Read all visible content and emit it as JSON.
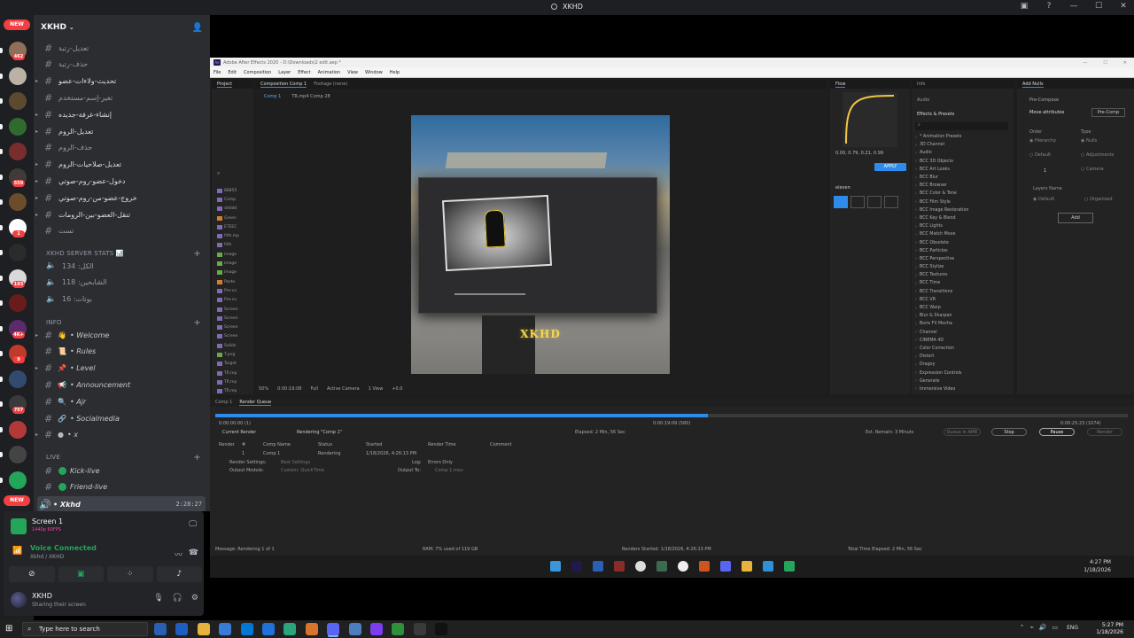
{
  "window": {
    "title": "XKHD",
    "controls": [
      "▣",
      "?",
      "—",
      "☐",
      "✕"
    ]
  },
  "rail": {
    "new_label": "NEW",
    "servers": [
      {
        "badge": "462",
        "color": "#8f6f5a"
      },
      {
        "badge": "",
        "color": "#b9b2a5"
      },
      {
        "badge": "",
        "color": "#5b4a2e"
      },
      {
        "badge": "",
        "color": "#2f6b2f"
      },
      {
        "badge": "",
        "color": "#7a2d2d"
      },
      {
        "badge": "559",
        "color": "#403b38"
      },
      {
        "badge": "",
        "color": "#6b4c2b"
      },
      {
        "badge": "1",
        "color": "#ffffff"
      },
      {
        "badge": "",
        "color": "#2b2b2b"
      },
      {
        "badge": "193",
        "color": "#d9d9d9"
      },
      {
        "badge": "",
        "color": "#6a1b1b"
      },
      {
        "badge": "4K+",
        "color": "#5e2a6e"
      },
      {
        "badge": "9",
        "color": "#c03a2b"
      },
      {
        "badge": "",
        "color": "#314a6e"
      },
      {
        "badge": "707",
        "color": "#3a3a3a"
      },
      {
        "badge": "",
        "color": "#b33939"
      },
      {
        "badge": "",
        "color": "#444444"
      },
      {
        "badge": "",
        "color": "#23a55a"
      }
    ]
  },
  "server": {
    "name": "XKHD"
  },
  "channels": {
    "text_top": [
      {
        "label": "تعديل-رتبة",
        "arrow": false,
        "bright": false
      },
      {
        "label": "حذف-رتبة",
        "arrow": false,
        "bright": false
      },
      {
        "label": "تحديث-ولاءات-عضو",
        "arrow": true,
        "bright": true
      },
      {
        "label": "تغير-إسم-مستخدم",
        "arrow": false,
        "bright": false
      },
      {
        "label": "إنشاء-غرفة-جديده",
        "arrow": true,
        "bright": true
      },
      {
        "label": "تعديل-الروم",
        "arrow": true,
        "bright": true
      },
      {
        "label": "حذف-الروم",
        "arrow": false,
        "bright": false
      },
      {
        "label": "تعديل-صلاحيات-الروم",
        "arrow": true,
        "bright": true
      },
      {
        "label": "دخول-عضو-روم-صوتي",
        "arrow": true,
        "bright": true
      },
      {
        "label": "خروج-عضو-من-روم-صوتي",
        "arrow": true,
        "bright": true
      },
      {
        "label": "تنقل-العضو-بين-الرومات",
        "arrow": true,
        "bright": true
      },
      {
        "label": "تست",
        "arrow": false,
        "bright": false
      }
    ],
    "stats_category": "XKHD SERVER STATS 📊",
    "stats": [
      "الكل: 134",
      "الشابحين: 118",
      "بوتات: 16"
    ],
    "info_category": "INFO",
    "info": [
      {
        "emoji": "👋",
        "label": "• Welcome",
        "arrow": true,
        "bright": true
      },
      {
        "emoji": "📜",
        "label": "• Rules",
        "arrow": false,
        "bright": false
      },
      {
        "emoji": "📌",
        "label": "• Level",
        "arrow": true,
        "bright": true
      },
      {
        "emoji": "📢",
        "label": "• Announcement",
        "arrow": false,
        "bright": false
      },
      {
        "emoji": "🔍",
        "label": "• Ajr",
        "arrow": false,
        "bright": false
      },
      {
        "emoji": "🔗",
        "label": "• Socialmedia",
        "arrow": false,
        "bright": false
      },
      {
        "emoji": "●",
        "label": "• x",
        "arrow": true,
        "bright": true
      }
    ],
    "live_category": "LIVE",
    "live": [
      {
        "label": "Kick-live"
      },
      {
        "label": "Friend-live"
      }
    ],
    "active_voice": {
      "label": "• Xkhd",
      "timer": "2:28:27"
    }
  },
  "voice_panel": {
    "screen_title": "Screen 1",
    "screen_sub": "1440p 60FPS",
    "connected_title": "Voice Connected",
    "connected_sub": "Xkhd / XKHD",
    "user_name": "XKHD",
    "user_status": "Sharing their screen"
  },
  "ae": {
    "title": "Adobe After Effects 2020 - D:\\Downloads\\2 edit.aep *",
    "menu": [
      "File",
      "Edit",
      "Composition",
      "Layer",
      "Effect",
      "Animation",
      "View",
      "Window",
      "Help"
    ],
    "project_tab": "Project",
    "comp_tab": "Composition Comp 1",
    "footage_tab": "Footage (none)",
    "comp_subtabs": [
      "Comp 1",
      "TR.mp4 Comp 28"
    ],
    "project_items": [
      "88855",
      "Comp",
      "ddddd",
      "Green",
      "ETEEC",
      "fdfs.mp",
      "fdfs",
      "image",
      "image",
      "image",
      "Paste",
      "Pre-co",
      "Pre-co",
      "Screen",
      "Screen",
      "Screen",
      "Screen",
      "Solids",
      "T.png",
      "Target",
      "TR.mp",
      "TR.mp",
      "TR.mp"
    ],
    "viewer_text": "XKHD",
    "viewer_zoom": "50%",
    "viewer_time": "0:00:19:08",
    "viewer_quality": "Full",
    "viewer_camera": "Active Camera",
    "viewer_views": "1 View",
    "viewer_extra": "+0.0",
    "flow_tab": "Flow",
    "flow_values": "0.00, 0.79, 0.21, 0.99",
    "flow_apply": "APPLY",
    "flow_preset": "eleven",
    "info_tab": "Info",
    "audio_tab": "Audio",
    "effects_tab": "Effects & Presets",
    "effects": [
      "* Animation Presets",
      "3D Channel",
      "Audio",
      "BCC 3D Objects",
      "BCC Art Looks",
      "BCC Blur",
      "BCC Browser",
      "BCC Color & Tone",
      "BCC Film Style",
      "BCC Image Restoration",
      "BCC Key & Blend",
      "BCC Lights",
      "BCC Match Move",
      "BCC Obsolete",
      "BCC Particles",
      "BCC Perspective",
      "BCC Stylize",
      "BCC Textures",
      "BCC Time",
      "BCC Transitions",
      "BCC VR",
      "BCC Warp",
      "Blur & Sharpen",
      "Boris FX Mocha",
      "Channel",
      "CINEMA 4D",
      "Color Correction",
      "Distort",
      "Dragoy",
      "Expression Controls",
      "Generate",
      "Immersive Video"
    ],
    "addnulls_tab": "Add Nulls",
    "precompose_label": "Pre-Compose",
    "move_attributes": "Move attributes",
    "precomp_btn": "Pre-Comp",
    "order_label": "Order",
    "type_label": "Type",
    "order_opts": [
      "Hierarchy",
      "Default"
    ],
    "type_opts": [
      "Nulls",
      "Adjustments",
      "Camera"
    ],
    "order_num": "1",
    "layers_name": "Layers Name",
    "layers_opts": [
      "Default",
      "Organized"
    ],
    "add_btn": "Add",
    "rq_tabs": [
      "Comp 1",
      "Render Queue"
    ],
    "rq_time_start": "0:00:00:00 (1)",
    "rq_time_cur": "0:00:19:09 (580)",
    "rq_time_end": "0:00:25:23 (1074)",
    "rq_current_render": "Current Render",
    "rq_rendering": "Rendering \"Comp 1\"",
    "rq_elapsed": "Elapsed: 2 Min, 56 Sec",
    "rq_remain": "Est. Remain: 3 Minuts",
    "rq_queue_btn": "Queue in AME",
    "rq_stop": "Stop",
    "rq_pause": "Pause",
    "rq_render": "Render",
    "rq_cols": [
      "Render",
      "#",
      "Comp Name",
      "Status",
      "Started",
      "Render Time",
      "Comment"
    ],
    "rq_row": {
      "num": "1",
      "comp": "Comp 1",
      "status": "Rendering",
      "started": "1/18/2026, 4:26:13 PM"
    },
    "rq_render_settings": "Render Settings:",
    "rq_render_settings_val": "Best Settings",
    "rq_output_module": "Output Module:",
    "rq_output_module_val": "Custom: QuickTime",
    "rq_log": "Log:",
    "rq_log_val": "Errors Only",
    "rq_output_to": "Output To:",
    "rq_output_to_val": "Comp 1.mov",
    "status_message": "Message: Rendering 1 of 1",
    "status_ram": "RAM: 7% used of 119 GB",
    "status_started": "Renders Started: 1/18/2026, 4:26:13 PM",
    "status_total": "Total Time Elapsed: 2 Min, 56 Sec"
  },
  "inner_clock": {
    "time": "4:27 PM",
    "date": "1/18/2026"
  },
  "taskbar": {
    "search_placeholder": "Type here to search",
    "lang": "ENG",
    "time": "5:27 PM",
    "date": "1/18/2026"
  }
}
